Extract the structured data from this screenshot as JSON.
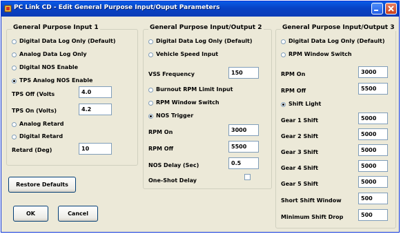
{
  "window": {
    "title": "PC Link CD - Edit General Purpose Input/Ouput Parameters"
  },
  "group1": {
    "title": "General Purpose Input 1",
    "options": [
      {
        "label": "Digital Data Log Only (Default)",
        "selected": false
      },
      {
        "label": "Analog Data Log Only",
        "selected": false
      },
      {
        "label": "Digital NOS Enable",
        "selected": false
      },
      {
        "label": "TPS Analog NOS Enable",
        "selected": true
      }
    ],
    "tps_off": {
      "label": "TPS Off (Volts",
      "value": "4.0"
    },
    "tps_on": {
      "label": "TPS On (Volts)",
      "value": "4.2"
    },
    "retard_options": [
      {
        "label": "Analog Retard",
        "selected": false
      },
      {
        "label": "Digital Retard",
        "selected": false
      }
    ],
    "retard": {
      "label": "Retard (Deg)",
      "value": "10"
    }
  },
  "group2": {
    "title": "General Purpose Input/Output 2",
    "options": [
      {
        "label": "Digital Data Log Only (Default)",
        "selected": false
      },
      {
        "label": "Vehicle Speed Input",
        "selected": false
      }
    ],
    "vss": {
      "label": "VSS Frequency",
      "value": "150"
    },
    "options2": [
      {
        "label": "Burnout RPM Limit Input",
        "selected": false
      },
      {
        "label": "RPM Window Switch",
        "selected": false
      },
      {
        "label": "NOS Trigger",
        "selected": true
      }
    ],
    "rpm_on": {
      "label": "RPM On",
      "value": "3000"
    },
    "rpm_off": {
      "label": "RPM Off",
      "value": "5500"
    },
    "nos_delay": {
      "label": "NOS Delay (Sec)",
      "value": "0.5"
    },
    "one_shot": {
      "label": "One-Shot Delay",
      "checked": false
    }
  },
  "group3": {
    "title": "General Purpose Input/Output 3",
    "options": [
      {
        "label": "Digital Data Log Only (Default)",
        "selected": false
      },
      {
        "label": "RPM Window Switch",
        "selected": false
      }
    ],
    "rpm_on": {
      "label": "RPM On",
      "value": "3000"
    },
    "rpm_off": {
      "label": "RPM Off",
      "value": "5500"
    },
    "shift_light": {
      "label": "Shift Light",
      "selected": true
    },
    "fields": [
      {
        "label": "Gear 1 Shift",
        "value": "5000"
      },
      {
        "label": "Gear 2 Shift",
        "value": "5000"
      },
      {
        "label": "Gear 3 Shift",
        "value": "5000"
      },
      {
        "label": "Gear 4 Shift",
        "value": "5000"
      },
      {
        "label": "Gear 5 Shift",
        "value": "5000"
      },
      {
        "label": "Short Shift Window",
        "value": "500"
      },
      {
        "label": "Minimum Shift Drop",
        "value": "500"
      }
    ]
  },
  "buttons": {
    "restore": "Restore Defaults",
    "ok": "OK",
    "cancel": "Cancel"
  }
}
